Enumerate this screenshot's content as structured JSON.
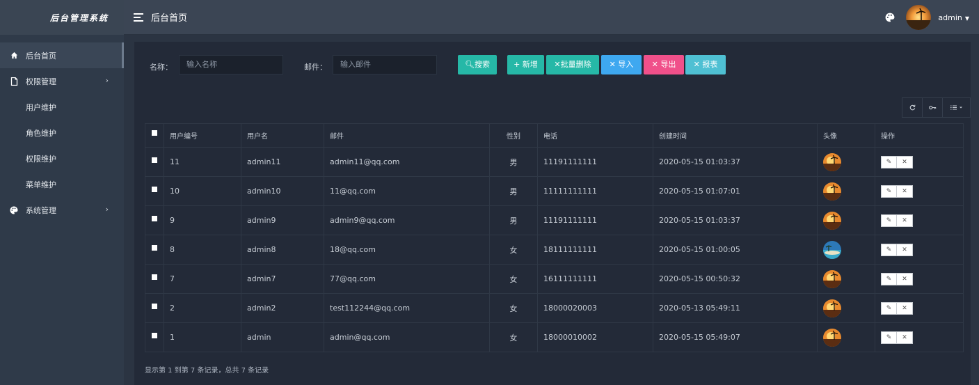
{
  "brand": {
    "title": "后台管理系统"
  },
  "sidebar": {
    "items": [
      {
        "label": "后台首页",
        "icon": "home-icon",
        "active": true
      },
      {
        "label": "权限管理",
        "icon": "file-icon",
        "expandable": true
      },
      {
        "label": "系统管理",
        "icon": "palette-icon",
        "expandable": true
      }
    ],
    "submenu": [
      {
        "label": "用户维护"
      },
      {
        "label": "角色维护"
      },
      {
        "label": "权限维护"
      },
      {
        "label": "菜单维护"
      }
    ]
  },
  "header": {
    "title": "后台首页",
    "user": "admin"
  },
  "search": {
    "name_label": "名称：",
    "name_placeholder": "输入名称",
    "email_label": "邮件：",
    "email_placeholder": "输入邮件",
    "search_btn": "搜索",
    "add_btn": "+ 新增",
    "batch_delete_btn": "批量删除",
    "import_btn": "导入",
    "export_btn": "导出",
    "report_btn": "报表"
  },
  "table": {
    "columns": [
      "用户编号",
      "用户名",
      "邮件",
      "性别",
      "电话",
      "创建时间",
      "头像",
      "操作"
    ],
    "rows": [
      {
        "id": "11",
        "username": "admin11",
        "email": "admin11@qq.com",
        "gender": "男",
        "phone": "11191111111",
        "created": "2020-05-15 01:03:37",
        "avatar": "sunset"
      },
      {
        "id": "10",
        "username": "admin10",
        "email": "11@qq.com",
        "gender": "男",
        "phone": "11111111111",
        "created": "2020-05-15 01:07:01",
        "avatar": "sunset"
      },
      {
        "id": "9",
        "username": "admin9",
        "email": "admin9@qq.com",
        "gender": "男",
        "phone": "11191111111",
        "created": "2020-05-15 01:03:37",
        "avatar": "sunset"
      },
      {
        "id": "8",
        "username": "admin8",
        "email": "18@qq.com",
        "gender": "女",
        "phone": "18111111111",
        "created": "2020-05-15 01:00:05",
        "avatar": "beach"
      },
      {
        "id": "7",
        "username": "admin7",
        "email": "77@qq.com",
        "gender": "女",
        "phone": "16111111111",
        "created": "2020-05-15 00:50:32",
        "avatar": "sunset"
      },
      {
        "id": "2",
        "username": "admin2",
        "email": "test112244@qq.com",
        "gender": "女",
        "phone": "18000020003",
        "created": "2020-05-13 05:49:11",
        "avatar": "sunset"
      },
      {
        "id": "1",
        "username": "admin",
        "email": "admin@qq.com",
        "gender": "女",
        "phone": "18000010002",
        "created": "2020-05-15 05:49:07",
        "avatar": "sunset"
      }
    ]
  },
  "pagination": {
    "summary": "显示第 1 到第 7 条记录，总共 7 条记录"
  },
  "colors": {
    "teal": "#26b8a7",
    "blue": "#3ea8f0",
    "pink": "#f0508a",
    "cyan": "#4fc0d3",
    "bg": "#232a38"
  }
}
